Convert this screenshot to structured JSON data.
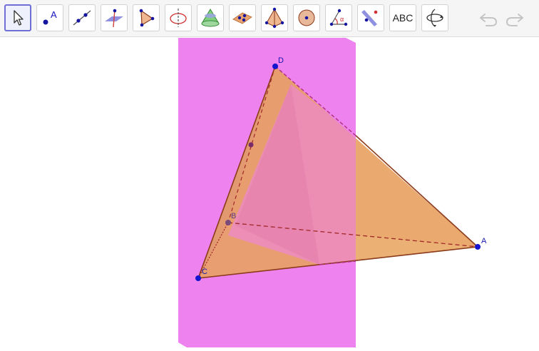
{
  "toolbar": {
    "tools": [
      {
        "name": "move-tool",
        "active": true
      },
      {
        "name": "point-tool",
        "glyph": "A"
      },
      {
        "name": "line-tool"
      },
      {
        "name": "perpendicular-tool"
      },
      {
        "name": "polygon-tool"
      },
      {
        "name": "circle-axis-tool"
      },
      {
        "name": "cone-tool"
      },
      {
        "name": "plane-through-points-tool"
      },
      {
        "name": "pyramid-tool"
      },
      {
        "name": "sphere-tool"
      },
      {
        "name": "angle-tool",
        "glyph": "α"
      },
      {
        "name": "reflect-tool"
      },
      {
        "name": "text-tool",
        "label": "ABC"
      },
      {
        "name": "rotate-view-tool"
      }
    ],
    "undo_icon": "undo-icon",
    "redo_icon": "redo-icon"
  },
  "scene": {
    "points": [
      {
        "label": "D"
      },
      {
        "label": "A"
      },
      {
        "label": "B"
      },
      {
        "label": "C"
      }
    ],
    "colors": {
      "plane": "#ee82ee",
      "face": "#e8a35c",
      "edge": "#8b3a1a",
      "point": "#1515d0",
      "label": "#1515b0"
    }
  }
}
